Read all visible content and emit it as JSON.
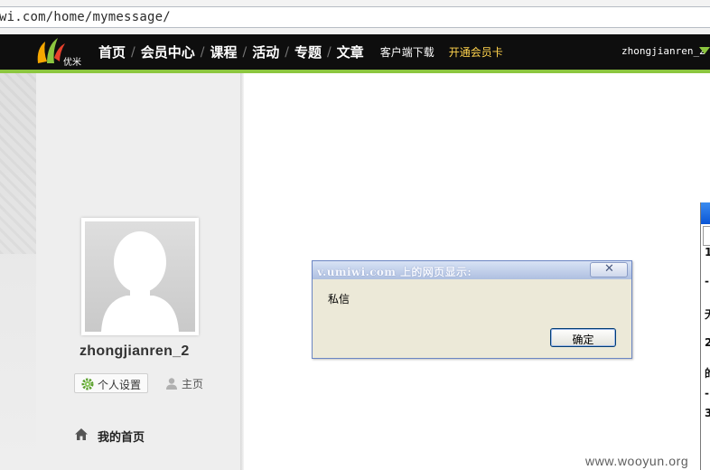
{
  "browser": {
    "url": "wi.com/home/mymessage/"
  },
  "nav": {
    "logo_text": "优米",
    "links": [
      "首页",
      "会员中心",
      "课程",
      "活动",
      "专题",
      "文章"
    ],
    "client_download": "客户端下载",
    "vip_card": "开通会员卡",
    "username": "zhongjianren_2"
  },
  "sidebar": {
    "username": "zhongjianren_2",
    "settings_label": "个人设置",
    "home_label": "主页",
    "my_home_label": "我的首页"
  },
  "dialog": {
    "title": "v.umiwi.com 上的网页显示:",
    "message": "私信",
    "ok_label": "确定"
  },
  "partial_window": {
    "chars": [
      "1",
      "-",
      "无",
      "2",
      "的",
      "-",
      "3"
    ]
  },
  "watermark": "www.wooyun.org",
  "colors": {
    "nav_bg": "#0e0e0e",
    "accent_green": "#8cc63f",
    "vip_yellow": "#ffd34d",
    "dialog_bg": "#ece9d8"
  }
}
